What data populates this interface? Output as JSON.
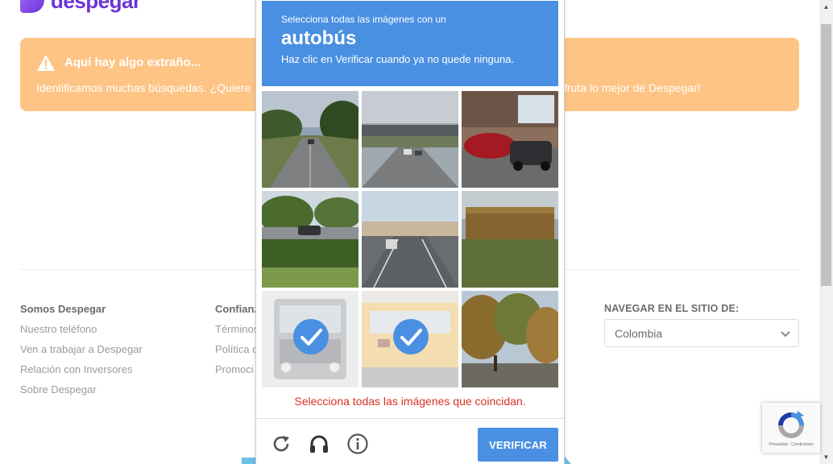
{
  "site": {
    "logo_text": "despegar",
    "alert": {
      "title": "Aquí hay algo extraño...",
      "text": "Identificamos muchas búsquedas. ¿Quiere",
      "text_tail": "fruta lo mejor de Despegar!"
    },
    "footer": {
      "col1": {
        "heading": "Somos Despegar",
        "links": [
          "Nuestro teléfono",
          "Ven a trabajar a Despegar",
          "Relación con Inversores",
          "Sobre Despegar"
        ]
      },
      "col2": {
        "heading": "Confianz",
        "links": [
          "Términos",
          "Política d",
          "Promoci"
        ]
      },
      "nav_site": {
        "label": "NAVEGAR EN EL SITIO DE:",
        "selected": "Colombia"
      }
    }
  },
  "captcha": {
    "line1": "Selecciona todas las imágenes con un",
    "keyword": "autobús",
    "line2": "Haz clic en Verificar cuando ya no quede ninguna.",
    "error": "Selecciona todas las imágenes que coincidan.",
    "verify_label": "VERIFICAR",
    "tiles": [
      {
        "scene": "road-trees",
        "selected": false
      },
      {
        "scene": "highway-overpass",
        "selected": false
      },
      {
        "scene": "parked-cars",
        "selected": false
      },
      {
        "scene": "parking-lot-hedge",
        "selected": false
      },
      {
        "scene": "road-toll",
        "selected": false
      },
      {
        "scene": "school-bus-field",
        "selected": false
      },
      {
        "scene": "bus-front",
        "selected": true
      },
      {
        "scene": "school-bus",
        "selected": true
      },
      {
        "scene": "autumn-trees",
        "selected": false
      }
    ],
    "tools": [
      "reload-icon",
      "audio-icon",
      "info-icon"
    ]
  },
  "recaptcha_badge": {
    "links": "Privacidad - Condiciones"
  },
  "colors": {
    "captcha_blue": "#4a90e2",
    "alert_orange": "#fec485",
    "error_red": "#d93025",
    "brand_purple": "#6b33d6"
  }
}
